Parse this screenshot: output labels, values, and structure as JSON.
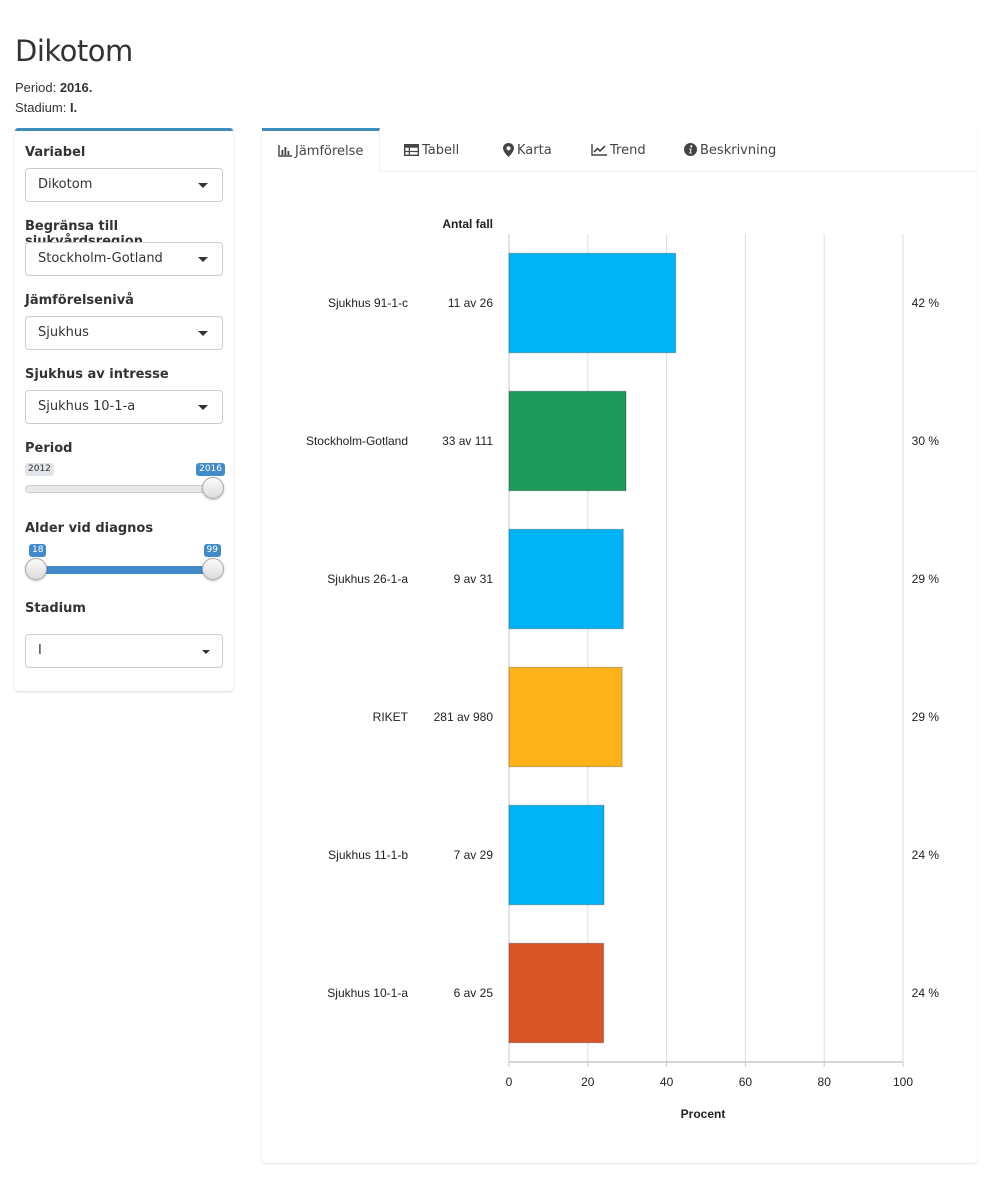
{
  "page": {
    "title": "Dikotom",
    "period_label": "Period:",
    "period_value": "2016.",
    "stadium_label": "Stadium:",
    "stadium_value": "I."
  },
  "sidebar": {
    "accent": "#3c8dbc",
    "variabel": {
      "label": "Variabel",
      "value": "Dikotom"
    },
    "region": {
      "label": "Begränsa till sjukvårdsregion",
      "value": "Stockholm-Gotland"
    },
    "level": {
      "label": "Jämförelsenivå",
      "value": "Sjukhus"
    },
    "hospital": {
      "label": "Sjukhus av intresse",
      "value": "Sjukhus 10-1-a"
    },
    "period": {
      "label": "Period",
      "min_label": "2012",
      "max_label": "2016",
      "min": 2012,
      "max": 2016,
      "value": 2016
    },
    "age": {
      "label": "Alder vid diagnos",
      "min": 18,
      "max": 99,
      "low": 18,
      "high": 99,
      "low_label": "18",
      "high_label": "99"
    },
    "stadium": {
      "label": "Stadium",
      "value": "I"
    }
  },
  "tabs": [
    {
      "label": "Jämförelse",
      "icon": "bar-chart-icon",
      "active": true
    },
    {
      "label": "Tabell",
      "icon": "table-icon",
      "active": false
    },
    {
      "label": "Karta",
      "icon": "map-marker-icon",
      "active": false
    },
    {
      "label": "Trend",
      "icon": "line-chart-icon",
      "active": false
    },
    {
      "label": "Beskrivning",
      "icon": "info-icon",
      "active": false
    }
  ],
  "chart_data": {
    "type": "bar",
    "orientation": "horizontal",
    "count_header": "Antal fall",
    "xlabel": "Procent",
    "xlim": [
      0,
      100
    ],
    "xticks": [
      0,
      20,
      40,
      60,
      80,
      100
    ],
    "grid": true,
    "categories": [
      "Sjukhus 91-1-c",
      "Stockholm-Gotland",
      "Sjukhus 26-1-a",
      "RIKET",
      "Sjukhus 11-1-b",
      "Sjukhus 10-1-a"
    ],
    "counts": [
      "11 av 26",
      "33 av 111",
      "9 av 31",
      "281 av 980",
      "7 av 29",
      "6 av 25"
    ],
    "values": [
      42.3,
      29.7,
      29.0,
      28.7,
      24.1,
      24.0
    ],
    "value_labels": [
      "42 %",
      "30 %",
      "29 %",
      "29 %",
      "24 %",
      "24 %"
    ],
    "colors": [
      "#00b3f6",
      "#1e9a5c",
      "#00b3f6",
      "#ffb31a",
      "#00b3f6",
      "#d95526"
    ]
  }
}
